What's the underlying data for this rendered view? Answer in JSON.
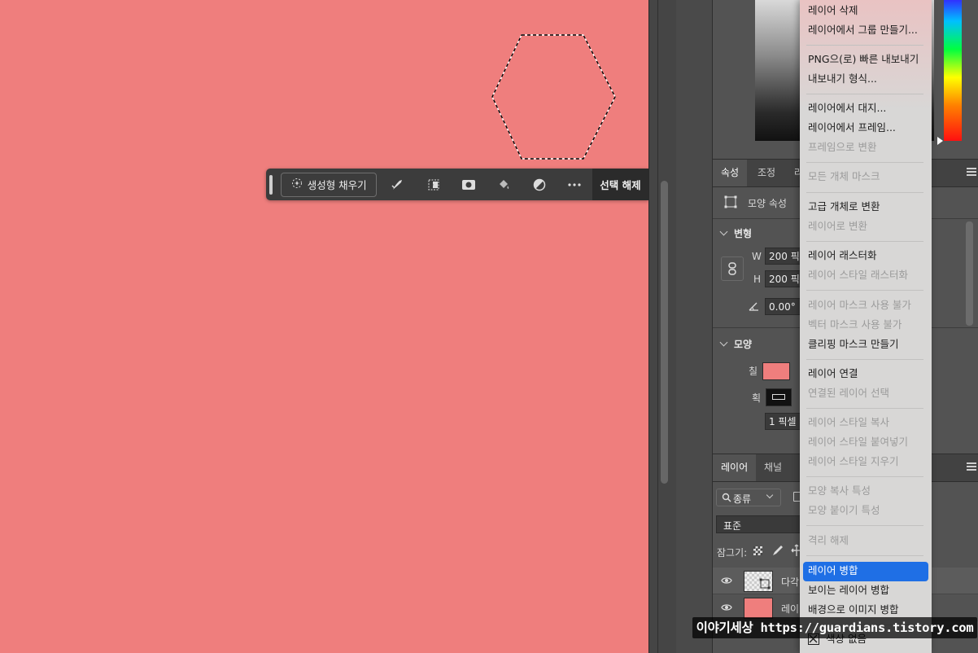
{
  "canvas": {
    "background_color": "#ef7e7d"
  },
  "taskbar": {
    "generative_fill_label": "생성형 채우기",
    "deselect_label": "선택 해제",
    "icons": [
      "brush-mask-icon",
      "transform-selection-icon",
      "mask-icon",
      "fill-bucket-icon",
      "adjustment-icon",
      "more-icon"
    ]
  },
  "properties_panel": {
    "tabs": [
      {
        "label": "속성"
      },
      {
        "label": "조정"
      },
      {
        "label": "라"
      }
    ],
    "shape_props_label": "모양 속성",
    "transform_label": "변형",
    "w_label": "W",
    "w_value": "200 픽",
    "h_label": "H",
    "h_value": "200 픽",
    "angle_value": "0.00°",
    "shape_label": "모양",
    "fill_label": "칠",
    "fill_color": "#ef7e7d",
    "stroke_label": "획",
    "stroke_width_value": "1 픽셀"
  },
  "layers_panel": {
    "tabs": [
      {
        "label": "레이어"
      },
      {
        "label": "채널"
      }
    ],
    "kind_label": "종류",
    "blend_mode": "표준",
    "lock_label": "잠그기:",
    "layers": [
      {
        "name": "다각",
        "thumb": "shape"
      },
      {
        "name": "레이",
        "thumb": "fill"
      }
    ]
  },
  "context_menu": {
    "items": [
      {
        "label": "레이어 삭제",
        "enabled": true
      },
      {
        "label": "레이어에서 그룹 만들기...",
        "enabled": true
      },
      {
        "label": "PNG으(로) 빠른 내보내기",
        "enabled": true
      },
      {
        "label": "내보내기 형식...",
        "enabled": true
      },
      {
        "label": "레이어에서 대지...",
        "enabled": true
      },
      {
        "label": "레이어에서 프레임...",
        "enabled": true
      },
      {
        "label": "프레임으로 변환",
        "enabled": false
      },
      {
        "label": "모든 개체 마스크",
        "enabled": false
      },
      {
        "label": "고급 개체로 변환",
        "enabled": true
      },
      {
        "label": "레이어로 변환",
        "enabled": false
      },
      {
        "label": "레이어 래스터화",
        "enabled": true
      },
      {
        "label": "레이어 스타일 래스터화",
        "enabled": false
      },
      {
        "label": "레이어 마스크 사용 불가",
        "enabled": false
      },
      {
        "label": "벡터 마스크 사용 불가",
        "enabled": false
      },
      {
        "label": "클리핑 마스크 만들기",
        "enabled": true
      },
      {
        "label": "레이어 연결",
        "enabled": true
      },
      {
        "label": "연결된 레이어 선택",
        "enabled": false
      },
      {
        "label": "레이어 스타일 복사",
        "enabled": false
      },
      {
        "label": "레이어 스타일 붙여넣기",
        "enabled": false
      },
      {
        "label": "레이어 스타일 지우기",
        "enabled": false
      },
      {
        "label": "모양 복사 특성",
        "enabled": false
      },
      {
        "label": "모양 붙이기 특성",
        "enabled": false
      },
      {
        "label": "격리 해제",
        "enabled": false
      },
      {
        "label": "레이어 병합",
        "enabled": true,
        "highlighted": true
      },
      {
        "label": "보이는 레이어 병합",
        "enabled": true
      },
      {
        "label": "배경으로 이미지 병합",
        "enabled": true
      },
      {
        "label": "색상 없음",
        "enabled": true
      }
    ]
  },
  "watermark": {
    "text": "이야기세상 https://guardians.tistory.com"
  },
  "colors": {
    "menu_highlight": "#1f6fe5",
    "canvas": "#ef7e7d"
  }
}
